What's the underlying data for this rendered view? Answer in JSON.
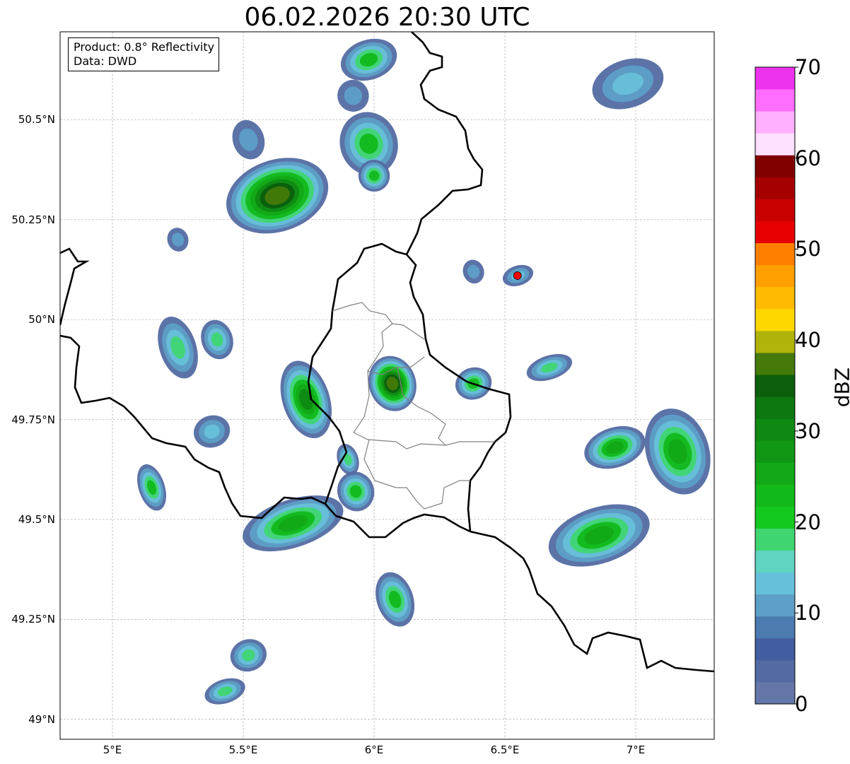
{
  "title": "06.02.2026 20:30 UTC",
  "info": {
    "product": "Product: 0.8° Reflectivity",
    "data_source": "Data: DWD"
  },
  "map": {
    "lon_range": [
      4.8,
      7.3
    ],
    "lat_range": [
      48.95,
      50.72
    ],
    "lat_ticks": [
      {
        "value": 50.5,
        "label": "50.5°N"
      },
      {
        "value": 50.25,
        "label": "50.25°N"
      },
      {
        "value": 50.0,
        "label": "50°N"
      },
      {
        "value": 49.75,
        "label": "49.75°N"
      },
      {
        "value": 49.5,
        "label": "49.5°N"
      },
      {
        "value": 49.25,
        "label": "49.25°N"
      },
      {
        "value": 49.0,
        "label": "49°N"
      }
    ],
    "lon_ticks": [
      {
        "value": 5.0,
        "label": "5°E"
      },
      {
        "value": 5.5,
        "label": "5.5°E"
      },
      {
        "value": 6.0,
        "label": "6°E"
      },
      {
        "value": 6.5,
        "label": "6.5°E"
      },
      {
        "value": 7.0,
        "label": "7°E"
      }
    ],
    "radar_site": {
      "lon": 6.548,
      "lat": 50.11,
      "color": "#ff0000"
    },
    "echo_cells": [
      {
        "lon": 5.63,
        "lat": 50.31,
        "rlon": 0.2,
        "rlat": 0.09,
        "peak": 40
      },
      {
        "lon": 5.52,
        "lat": 50.45,
        "rlon": 0.06,
        "rlat": 0.05,
        "peak": 10
      },
      {
        "lon": 5.98,
        "lat": 50.44,
        "rlon": 0.11,
        "rlat": 0.08,
        "peak": 22
      },
      {
        "lon": 6.0,
        "lat": 50.36,
        "rlon": 0.06,
        "rlat": 0.04,
        "peak": 24
      },
      {
        "lon": 5.98,
        "lat": 50.65,
        "rlon": 0.11,
        "rlat": 0.05,
        "peak": 24
      },
      {
        "lon": 5.92,
        "lat": 50.56,
        "rlon": 0.06,
        "rlat": 0.04,
        "peak": 10
      },
      {
        "lon": 6.97,
        "lat": 50.59,
        "rlon": 0.14,
        "rlat": 0.06,
        "peak": 14
      },
      {
        "lon": 5.25,
        "lat": 49.93,
        "rlon": 0.07,
        "rlat": 0.08,
        "peak": 20
      },
      {
        "lon": 5.4,
        "lat": 49.95,
        "rlon": 0.06,
        "rlat": 0.05,
        "peak": 18
      },
      {
        "lon": 5.74,
        "lat": 49.8,
        "rlon": 0.09,
        "rlat": 0.1,
        "peak": 30
      },
      {
        "lon": 6.07,
        "lat": 49.84,
        "rlon": 0.09,
        "rlat": 0.07,
        "peak": 38
      },
      {
        "lon": 6.38,
        "lat": 49.84,
        "rlon": 0.07,
        "rlat": 0.04,
        "peak": 22
      },
      {
        "lon": 6.67,
        "lat": 49.88,
        "rlon": 0.09,
        "rlat": 0.03,
        "peak": 18
      },
      {
        "lon": 5.38,
        "lat": 49.72,
        "rlon": 0.07,
        "rlat": 0.04,
        "peak": 16
      },
      {
        "lon": 5.15,
        "lat": 49.58,
        "rlon": 0.05,
        "rlat": 0.06,
        "peak": 22
      },
      {
        "lon": 5.69,
        "lat": 49.49,
        "rlon": 0.2,
        "rlat": 0.06,
        "peak": 28
      },
      {
        "lon": 5.93,
        "lat": 49.57,
        "rlon": 0.07,
        "rlat": 0.05,
        "peak": 24
      },
      {
        "lon": 6.08,
        "lat": 49.3,
        "rlon": 0.07,
        "rlat": 0.07,
        "peak": 24
      },
      {
        "lon": 5.52,
        "lat": 49.16,
        "rlon": 0.07,
        "rlat": 0.04,
        "peak": 18
      },
      {
        "lon": 5.43,
        "lat": 49.07,
        "rlon": 0.08,
        "rlat": 0.03,
        "peak": 18
      },
      {
        "lon": 6.86,
        "lat": 49.46,
        "rlon": 0.2,
        "rlat": 0.07,
        "peak": 26
      },
      {
        "lon": 6.92,
        "lat": 49.68,
        "rlon": 0.12,
        "rlat": 0.05,
        "peak": 28
      },
      {
        "lon": 7.16,
        "lat": 49.67,
        "rlon": 0.12,
        "rlat": 0.11,
        "peak": 28
      },
      {
        "lon": 6.55,
        "lat": 50.11,
        "rlon": 0.06,
        "rlat": 0.025,
        "peak": 16
      },
      {
        "lon": 6.38,
        "lat": 50.12,
        "rlon": 0.04,
        "rlat": 0.03,
        "peak": 10
      },
      {
        "lon": 5.25,
        "lat": 50.2,
        "rlon": 0.04,
        "rlat": 0.03,
        "peak": 12
      },
      {
        "lon": 5.9,
        "lat": 49.65,
        "rlon": 0.04,
        "rlat": 0.04,
        "peak": 18
      }
    ]
  },
  "colorbar": {
    "label": "dBZ",
    "min": 0,
    "max": 70,
    "colors": [
      "#6477a8",
      "#536ba2",
      "#435ea0",
      "#4b7bb0",
      "#5d9fc6",
      "#67c0d9",
      "#5fd4c0",
      "#3fd672",
      "#13c81e",
      "#11b91b",
      "#12a817",
      "#119715",
      "#0f8913",
      "#0d7710",
      "#0b5f0c",
      "#457a0a",
      "#b0b40a",
      "#ffd700",
      "#ffbb00",
      "#ff9f00",
      "#ff7f00",
      "#e60000",
      "#c80000",
      "#a40000",
      "#800000",
      "#ffe0ff",
      "#ffb0ff",
      "#ff6eff",
      "#ee33ee"
    ],
    "ticks": [
      {
        "value": 0,
        "label": "0"
      },
      {
        "value": 10,
        "label": "10"
      },
      {
        "value": 20,
        "label": "20"
      },
      {
        "value": 30,
        "label": "30"
      },
      {
        "value": 40,
        "label": "40"
      },
      {
        "value": 50,
        "label": "50"
      },
      {
        "value": 60,
        "label": "60"
      },
      {
        "value": 70,
        "label": "70"
      }
    ]
  }
}
